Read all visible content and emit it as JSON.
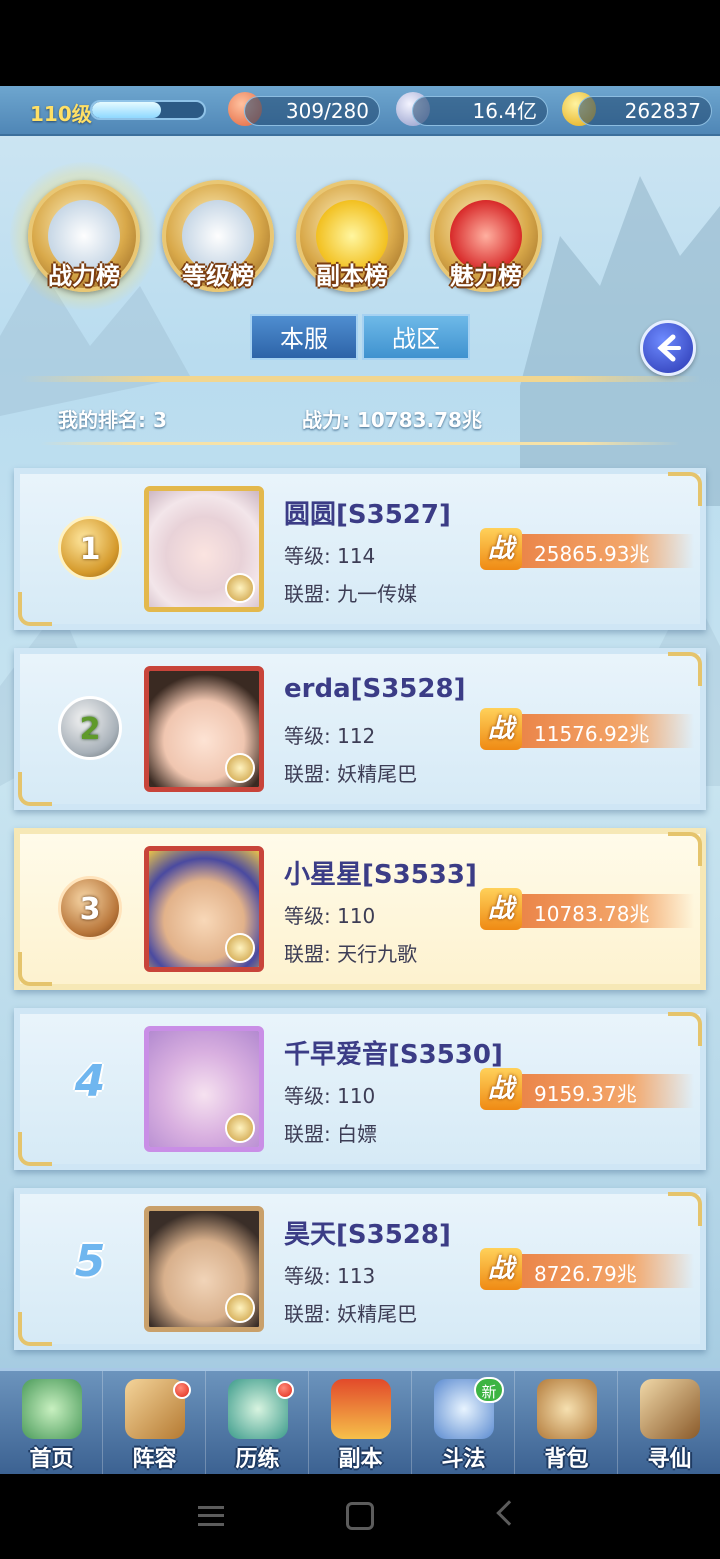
{
  "resources": {
    "level": "110级",
    "xp_fraction": 0.62,
    "stamina": "309/280",
    "coins": "16.4亿",
    "gold": "262837"
  },
  "categories": [
    {
      "label": "战力榜",
      "icon": "sword-emblem-icon",
      "active": true
    },
    {
      "label": "等级榜",
      "icon": "drum-emblem-icon",
      "active": false
    },
    {
      "label": "副本榜",
      "icon": "star-emblem-icon",
      "active": false
    },
    {
      "label": "魅力榜",
      "icon": "heart-emblem-icon",
      "active": false
    }
  ],
  "tabs": [
    {
      "label": "本服",
      "active": true
    },
    {
      "label": "战区",
      "active": false
    }
  ],
  "summary": {
    "my_rank": "我的排名: 3",
    "my_power": "战力: 10783.78兆"
  },
  "power_badge": "战",
  "rankings": [
    {
      "rank": "1",
      "name": "圆圆[S3527]",
      "level": "等级: 114",
      "guild": "联盟: 九一传媒",
      "power": "25865.93兆"
    },
    {
      "rank": "2",
      "name": "erda[S3528]",
      "level": "等级: 112",
      "guild": "联盟: 妖精尾巴",
      "power": "11576.92兆"
    },
    {
      "rank": "3",
      "name": "小星星[S3533]",
      "level": "等级: 110",
      "guild": "联盟: 天行九歌",
      "power": "10783.78兆"
    },
    {
      "rank": "4",
      "name": "千早爱音[S3530]",
      "level": "等级: 110",
      "guild": "联盟: 白嫖",
      "power": "9159.37兆"
    },
    {
      "rank": "5",
      "name": "昊天[S3528]",
      "level": "等级: 113",
      "guild": "联盟: 妖精尾巴",
      "power": "8726.79兆"
    }
  ],
  "nav": [
    {
      "label": "首页",
      "icon": "home-island-icon",
      "badge": ""
    },
    {
      "label": "阵容",
      "icon": "cards-icon",
      "badge": "dot"
    },
    {
      "label": "历练",
      "icon": "gourd-icon",
      "badge": "dot"
    },
    {
      "label": "副本",
      "icon": "gate-icon",
      "badge": ""
    },
    {
      "label": "斗法",
      "icon": "battle-icon",
      "badge": "新"
    },
    {
      "label": "背包",
      "icon": "bag-icon",
      "badge": ""
    },
    {
      "label": "寻仙",
      "icon": "scroll-icon",
      "badge": ""
    }
  ],
  "colors": {
    "accent_gold": "#e3b84c",
    "name_text": "#3b3c86",
    "power_bar": "#e87a3e",
    "my_card": "#fffbea"
  }
}
